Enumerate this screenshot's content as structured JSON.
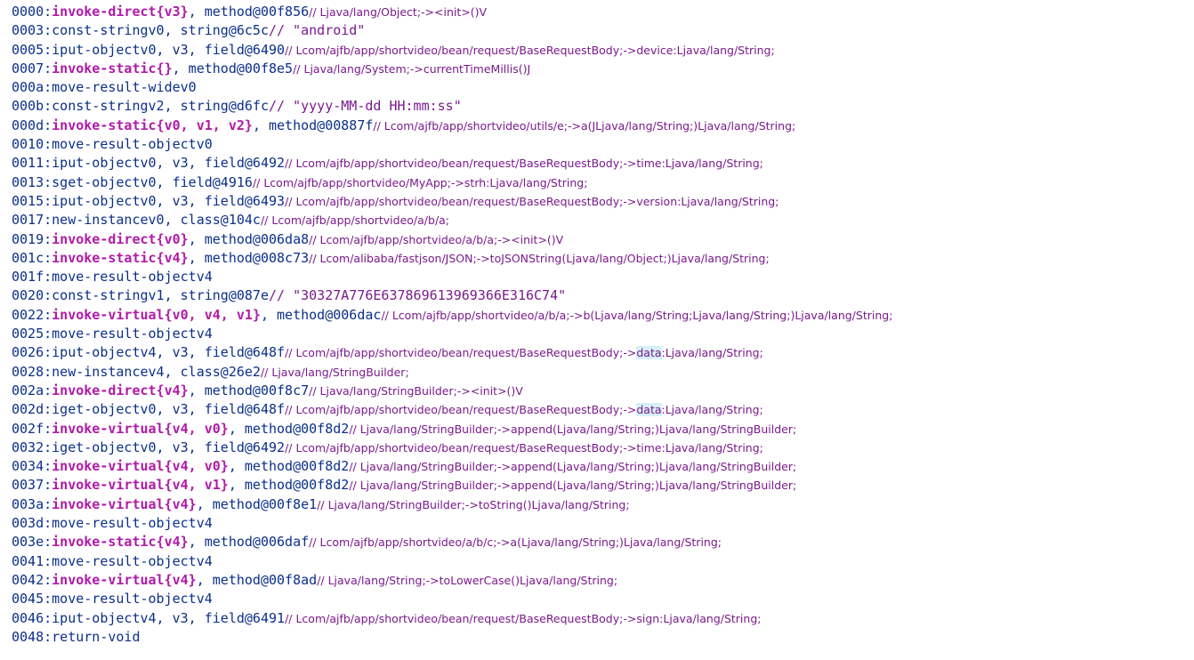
{
  "lines": [
    {
      "addr": "0000:",
      "op": "invoke-direct",
      "regs": "{v3}",
      "operand": ", method@00f856",
      "comment_pre": "// Ljava/lang/Object;-><init>()V",
      "invoke": true
    },
    {
      "addr": "0003:",
      "op": "const-string",
      "operand": "v0, string@6c5c",
      "str": "// \"android\""
    },
    {
      "addr": "0005:",
      "op": "iput-object",
      "operand": "v0, v3, field@6490",
      "comment_pre": "// Lcom/ajfb/app/shortvideo/bean/request/BaseRequestBody;->device:Ljava/lang/String;"
    },
    {
      "addr": "0007:",
      "op": "invoke-static",
      "regs": "{}",
      "operand": ", method@00f8e5",
      "comment_pre": "// Ljava/lang/System;->currentTimeMillis()J",
      "invoke": true
    },
    {
      "addr": "000a:",
      "op": "move-result-wide",
      "operand": "v0"
    },
    {
      "addr": "000b:",
      "op": "const-string",
      "operand": "v2, string@d6fc",
      "str": "// \"yyyy-MM-dd HH:mm:ss\""
    },
    {
      "addr": "000d:",
      "op": "invoke-static",
      "regs": "{v0, v1, v2}",
      "operand": ", method@00887f",
      "comment_pre": "// Lcom/ajfb/app/shortvideo/utils/e;->a(JLjava/lang/String;)Ljava/lang/String;",
      "invoke": true
    },
    {
      "addr": "0010:",
      "op": "move-result-object",
      "operand": "v0"
    },
    {
      "addr": "0011:",
      "op": "iput-object",
      "operand": "v0, v3, field@6492",
      "comment_pre": "// Lcom/ajfb/app/shortvideo/bean/request/BaseRequestBody;->time:Ljava/lang/String;"
    },
    {
      "addr": "0013:",
      "op": "sget-object",
      "operand": "v0, field@4916",
      "comment_pre": "// Lcom/ajfb/app/shortvideo/MyApp;->strh:Ljava/lang/String;"
    },
    {
      "addr": "0015:",
      "op": "iput-object",
      "operand": "v0, v3, field@6493",
      "comment_pre": "// Lcom/ajfb/app/shortvideo/bean/request/BaseRequestBody;->version:Ljava/lang/String;"
    },
    {
      "addr": "0017:",
      "op": "new-instance",
      "operand": "v0, class@104c",
      "comment_pre": "// Lcom/ajfb/app/shortvideo/a/b/a;"
    },
    {
      "addr": "0019:",
      "op": "invoke-direct",
      "regs": "{v0}",
      "operand": ", method@006da8",
      "comment_pre": "// Lcom/ajfb/app/shortvideo/a/b/a;-><init>()V",
      "invoke": true
    },
    {
      "addr": "001c:",
      "op": "invoke-static",
      "regs": "{v4}",
      "operand": ", method@008c73",
      "comment_pre": "// Lcom/alibaba/fastjson/JSON;->toJSONString(Ljava/lang/Object;)Ljava/lang/String;",
      "invoke": true
    },
    {
      "addr": "001f:",
      "op": "move-result-object",
      "operand": "v4"
    },
    {
      "addr": "0020:",
      "op": "const-string",
      "operand": "v1, string@087e",
      "str": "// \"30327A776E637869613969366E316C74\""
    },
    {
      "addr": "0022:",
      "op": "invoke-virtual",
      "regs": "{v0, v4, v1}",
      "operand": ", method@006dac",
      "comment_pre": "// Lcom/ajfb/app/shortvideo/a/b/a;->b(Ljava/lang/String;Ljava/lang/String;)Ljava/lang/String;",
      "invoke": true
    },
    {
      "addr": "0025:",
      "op": "move-result-object",
      "operand": "v4"
    },
    {
      "addr": "0026:",
      "op": "iput-object",
      "operand": "v4, v3, field@648f",
      "comment_pre": "// Lcom/ajfb/app/shortvideo/bean/request/BaseRequestBody;->",
      "hl": "data",
      "comment_post": ":Ljava/lang/String;"
    },
    {
      "addr": "0028:",
      "op": "new-instance",
      "operand": "v4, class@26e2",
      "comment_pre": "// Ljava/lang/StringBuilder;"
    },
    {
      "addr": "002a:",
      "op": "invoke-direct",
      "regs": "{v4}",
      "operand": ", method@00f8c7",
      "comment_pre": "// Ljava/lang/StringBuilder;-><init>()V",
      "invoke": true
    },
    {
      "addr": "002d:",
      "op": "iget-object",
      "operand": "v0, v3, field@648f",
      "comment_pre": "// Lcom/ajfb/app/shortvideo/bean/request/BaseRequestBody;->",
      "hl": "data",
      "comment_post": ":Ljava/lang/String;"
    },
    {
      "addr": "002f:",
      "op": "invoke-virtual",
      "regs": "{v4, v0}",
      "operand": ", method@00f8d2",
      "comment_pre": "// Ljava/lang/StringBuilder;->append(Ljava/lang/String;)Ljava/lang/StringBuilder;",
      "invoke": true
    },
    {
      "addr": "0032:",
      "op": "iget-object",
      "operand": "v0, v3, field@6492",
      "comment_pre": "// Lcom/ajfb/app/shortvideo/bean/request/BaseRequestBody;->time:Ljava/lang/String;"
    },
    {
      "addr": "0034:",
      "op": "invoke-virtual",
      "regs": "{v4, v0}",
      "operand": ", method@00f8d2",
      "comment_pre": "// Ljava/lang/StringBuilder;->append(Ljava/lang/String;)Ljava/lang/StringBuilder;",
      "invoke": true
    },
    {
      "addr": "0037:",
      "op": "invoke-virtual",
      "regs": "{v4, v1}",
      "operand": ", method@00f8d2",
      "comment_pre": "// Ljava/lang/StringBuilder;->append(Ljava/lang/String;)Ljava/lang/StringBuilder;",
      "invoke": true
    },
    {
      "addr": "003a:",
      "op": "invoke-virtual",
      "regs": "{v4}",
      "operand": ", method@00f8e1",
      "comment_pre": "// Ljava/lang/StringBuilder;->toString()Ljava/lang/String;",
      "invoke": true
    },
    {
      "addr": "003d:",
      "op": "move-result-object",
      "operand": "v4"
    },
    {
      "addr": "003e:",
      "op": "invoke-static",
      "regs": "{v4}",
      "operand": ", method@006daf",
      "comment_pre": "// Lcom/ajfb/app/shortvideo/a/b/c;->a(Ljava/lang/String;)Ljava/lang/String;",
      "invoke": true
    },
    {
      "addr": "0041:",
      "op": "move-result-object",
      "operand": "v4"
    },
    {
      "addr": "0042:",
      "op": "invoke-virtual",
      "regs": "{v4}",
      "operand": ", method@00f8ad",
      "comment_pre": "// Ljava/lang/String;->toLowerCase()Ljava/lang/String;",
      "invoke": true
    },
    {
      "addr": "0045:",
      "op": "move-result-object",
      "operand": "v4"
    },
    {
      "addr": "0046:",
      "op": "iput-object",
      "operand": "v4, v3, field@6491",
      "comment_pre": "// Lcom/ajfb/app/shortvideo/bean/request/BaseRequestBody;->sign:Ljava/lang/String;"
    },
    {
      "addr": "0048:",
      "op": "return-void"
    }
  ]
}
